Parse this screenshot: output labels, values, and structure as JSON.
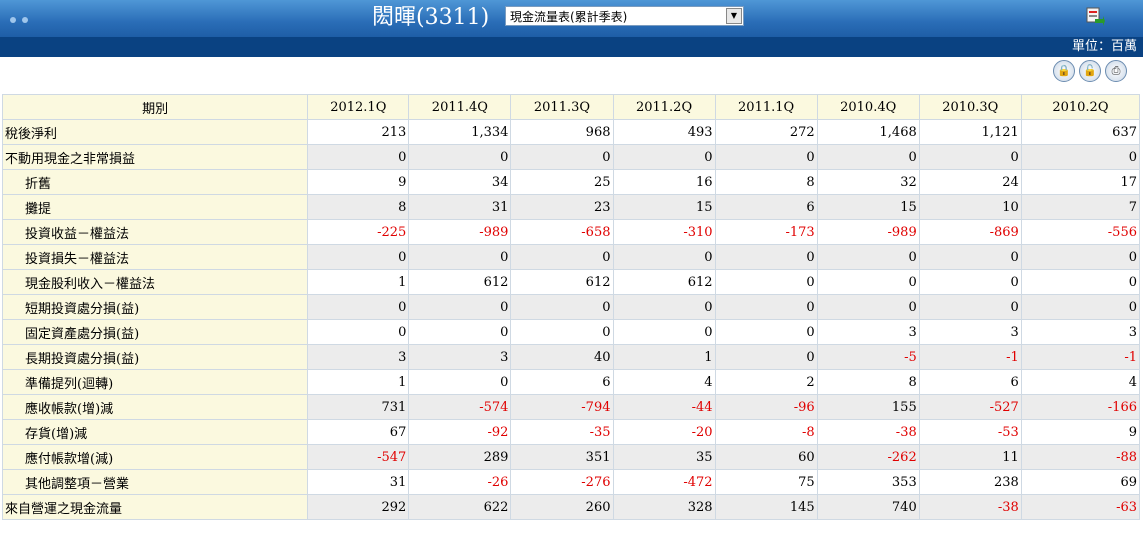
{
  "header": {
    "title": "閎暉(3311)",
    "report_select": "現金流量表(累計季表)",
    "unit": "單位：百萬"
  },
  "table": {
    "header_label": "期別",
    "columns": [
      "2012.1Q",
      "2011.4Q",
      "2011.3Q",
      "2011.2Q",
      "2011.1Q",
      "2010.4Q",
      "2010.3Q",
      "2010.2Q"
    ],
    "rows": [
      {
        "label": "稅後淨利",
        "indent": false,
        "values": [
          "213",
          "1,334",
          "968",
          "493",
          "272",
          "1,468",
          "1,121",
          "637"
        ]
      },
      {
        "label": "不動用現金之非常損益",
        "indent": false,
        "values": [
          "0",
          "0",
          "0",
          "0",
          "0",
          "0",
          "0",
          "0"
        ]
      },
      {
        "label": "折舊",
        "indent": true,
        "values": [
          "9",
          "34",
          "25",
          "16",
          "8",
          "32",
          "24",
          "17"
        ]
      },
      {
        "label": "攤提",
        "indent": true,
        "values": [
          "8",
          "31",
          "23",
          "15",
          "6",
          "15",
          "10",
          "7"
        ]
      },
      {
        "label": "投資收益－權益法",
        "indent": true,
        "values": [
          "-225",
          "-989",
          "-658",
          "-310",
          "-173",
          "-989",
          "-869",
          "-556"
        ]
      },
      {
        "label": "投資損失－權益法",
        "indent": true,
        "values": [
          "0",
          "0",
          "0",
          "0",
          "0",
          "0",
          "0",
          "0"
        ]
      },
      {
        "label": "現金股利收入－權益法",
        "indent": true,
        "values": [
          "1",
          "612",
          "612",
          "612",
          "0",
          "0",
          "0",
          "0"
        ]
      },
      {
        "label": "短期投資處分損(益)",
        "indent": true,
        "values": [
          "0",
          "0",
          "0",
          "0",
          "0",
          "0",
          "0",
          "0"
        ]
      },
      {
        "label": "固定資產處分損(益)",
        "indent": true,
        "values": [
          "0",
          "0",
          "0",
          "0",
          "0",
          "3",
          "3",
          "3"
        ]
      },
      {
        "label": "長期投資處分損(益)",
        "indent": true,
        "values": [
          "3",
          "3",
          "40",
          "1",
          "0",
          "-5",
          "-1",
          "-1"
        ]
      },
      {
        "label": "準備提列(迴轉)",
        "indent": true,
        "values": [
          "1",
          "0",
          "6",
          "4",
          "2",
          "8",
          "6",
          "4"
        ]
      },
      {
        "label": "應收帳款(增)減",
        "indent": true,
        "values": [
          "731",
          "-574",
          "-794",
          "-44",
          "-96",
          "155",
          "-527",
          "-166"
        ]
      },
      {
        "label": "存貨(增)減",
        "indent": true,
        "values": [
          "67",
          "-92",
          "-35",
          "-20",
          "-8",
          "-38",
          "-53",
          "9"
        ]
      },
      {
        "label": "應付帳款增(減)",
        "indent": true,
        "values": [
          "-547",
          "289",
          "351",
          "35",
          "60",
          "-262",
          "11",
          "-88"
        ]
      },
      {
        "label": "其他調整項－營業",
        "indent": true,
        "values": [
          "31",
          "-26",
          "-276",
          "-472",
          "75",
          "353",
          "238",
          "69"
        ]
      },
      {
        "label": "來自營運之現金流量",
        "indent": false,
        "values": [
          "292",
          "622",
          "260",
          "328",
          "145",
          "740",
          "-38",
          "-63"
        ]
      }
    ]
  },
  "colors": {
    "negative": "#e00000",
    "header_bg": "#2a6db7",
    "unit_bar": "#0a4282",
    "label_bg": "#fbf9df"
  },
  "icons": [
    "excel-export-icon",
    "lock-icon",
    "unlock-icon",
    "print-icon"
  ]
}
